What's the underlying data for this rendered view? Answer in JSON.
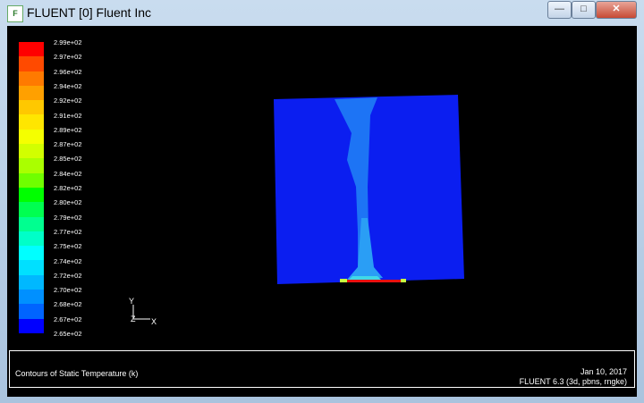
{
  "window": {
    "title": "FLUENT [0] Fluent Inc",
    "icon": "fluent-app-icon",
    "minimize": "minimize-icon",
    "maximize": "maximize-icon",
    "close": "close-icon"
  },
  "colorbar": {
    "labels": [
      "2.99e+02",
      "2.97e+02",
      "2.96e+02",
      "2.94e+02",
      "2.92e+02",
      "2.91e+02",
      "2.89e+02",
      "2.87e+02",
      "2.85e+02",
      "2.84e+02",
      "2.82e+02",
      "2.80e+02",
      "2.79e+02",
      "2.77e+02",
      "2.75e+02",
      "2.74e+02",
      "2.72e+02",
      "2.70e+02",
      "2.68e+02",
      "2.67e+02",
      "2.65e+02"
    ],
    "colors": [
      "#ff0000",
      "#ff4a00",
      "#ff7a00",
      "#ffa000",
      "#ffc800",
      "#ffe600",
      "#f5ff00",
      "#d2ff00",
      "#aaff00",
      "#70ff00",
      "#00ff00",
      "#00ff50",
      "#00ff90",
      "#00ffc8",
      "#00ffff",
      "#00e0ff",
      "#00b8ff",
      "#0090ff",
      "#0064ff",
      "#0000ff"
    ]
  },
  "axes": {
    "y": "Y",
    "z": "Z",
    "x": "X"
  },
  "footer": {
    "description": "Contours of Static Temperature (k)",
    "date": "Jan 10, 2017",
    "version": "FLUENT 6.3 (3d, pbns, rngke)"
  }
}
